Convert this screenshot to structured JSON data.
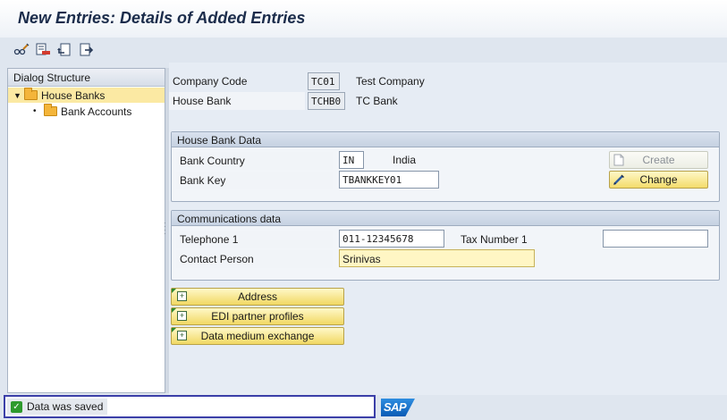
{
  "title": "New Entries: Details of Added Entries",
  "toolbar": {
    "icons": [
      "glasses-pencil-icon",
      "delete-entry-icon",
      "undo-icon",
      "copy-icon"
    ]
  },
  "dialog": {
    "header": "Dialog Structure",
    "items": [
      {
        "label": "House Banks",
        "selected": true
      },
      {
        "label": "Bank Accounts",
        "selected": false
      }
    ]
  },
  "header_fields": {
    "company_code": {
      "label": "Company Code",
      "value": "TC01",
      "desc": "Test Company"
    },
    "house_bank": {
      "label": "House Bank",
      "value": "TCHB0",
      "desc": "TC Bank"
    }
  },
  "house_bank_data": {
    "title": "House Bank Data",
    "bank_country": {
      "label": "Bank Country",
      "value": "IN",
      "desc": "India"
    },
    "bank_key": {
      "label": "Bank Key",
      "value": "TBANKKEY01"
    },
    "create_label": "Create",
    "change_label": "Change"
  },
  "communications": {
    "title": "Communications data",
    "telephone": {
      "label": "Telephone 1",
      "value": "011-12345678"
    },
    "tax_number": {
      "label": "Tax Number 1",
      "value": ""
    },
    "contact": {
      "label": "Contact Person",
      "value": "Srinivas"
    }
  },
  "buttons": {
    "address": "Address",
    "edi": "EDI partner profiles",
    "dme": "Data medium exchange"
  },
  "status": {
    "message": "Data was saved",
    "logo": "SAP"
  },
  "colors": {
    "accent_yellow": "#f3dc6b",
    "status_border": "#3b3fa8",
    "success_green": "#2e9a2e"
  }
}
